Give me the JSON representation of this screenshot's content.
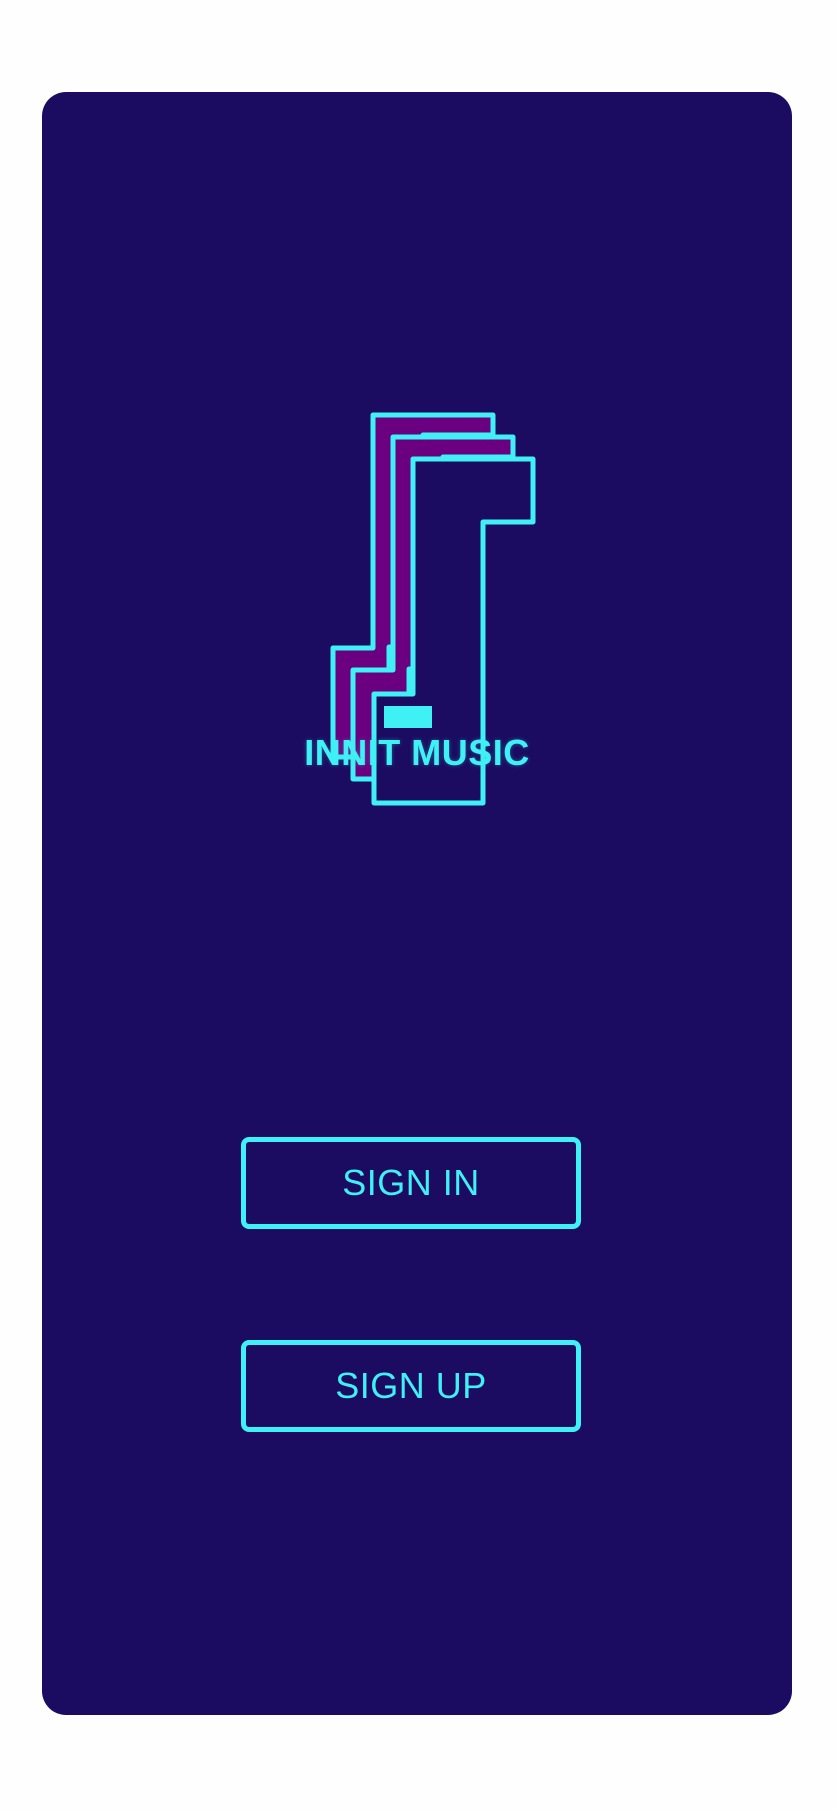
{
  "app": {
    "name": "INNIT MUSIC",
    "logo_icon": "music-note-icon"
  },
  "actions": {
    "sign_in_label": "SIGN IN",
    "sign_up_label": "SIGN UP"
  },
  "colors": {
    "background": "#1b0c61",
    "accent": "#3ff0f4",
    "secondary": "#6a007f",
    "page": "#fefefe"
  }
}
